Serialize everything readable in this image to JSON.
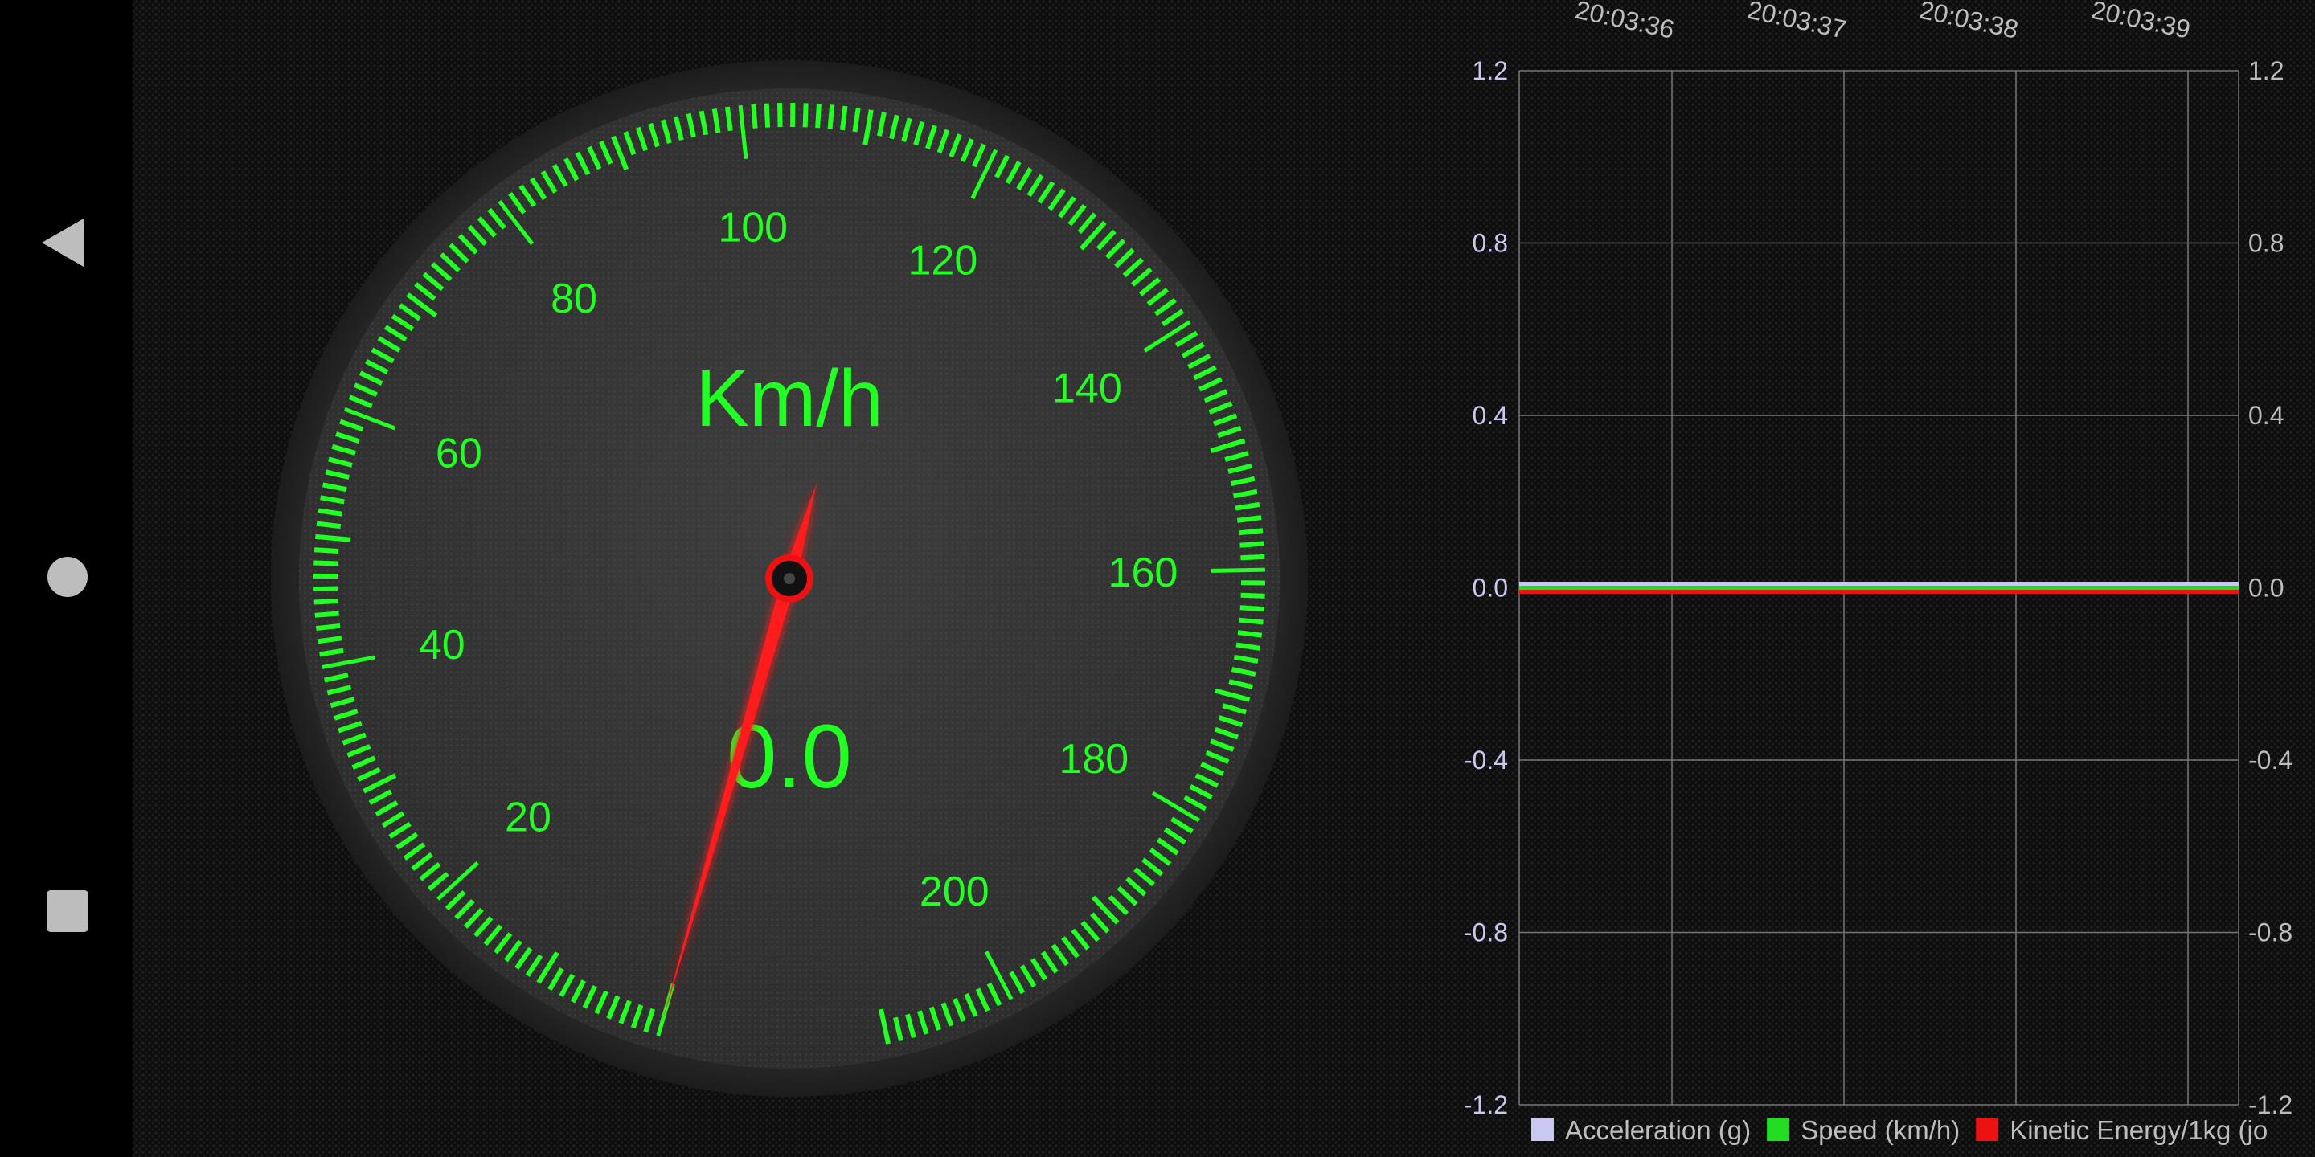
{
  "nav": {
    "back_icon": "triangle-back-icon",
    "home_icon": "circle-home-icon",
    "recents_icon": "square-recents-icon"
  },
  "speedometer": {
    "unit": "Km/h",
    "speed_value": "0.0",
    "speed": 0,
    "scale_labels": [
      "20",
      "40",
      "60",
      "80",
      "100",
      "120",
      "140",
      "160",
      "180",
      "200"
    ],
    "scale_min": 0,
    "scale_max": 210,
    "colors": {
      "ticks": "#22ff22",
      "needle": "#ff1a1a",
      "face": "#3a3a3a"
    }
  },
  "chart_data": {
    "type": "line",
    "x_labels": [
      "20:03:36",
      "20:03:37",
      "20:03:38",
      "20:03:39"
    ],
    "y_ticks_left": [
      "1.2",
      "0.8",
      "0.4",
      "0.0",
      "-0.4",
      "-0.8",
      "-1.2"
    ],
    "y_ticks_right": [
      "1.2",
      "0.8",
      "0.4",
      "0.0",
      "-0.4",
      "-0.8",
      "-1.2"
    ],
    "ylim": [
      -1.2,
      1.2
    ],
    "grid": true,
    "legend_position": "bottom",
    "series": [
      {
        "name": "Acceleration (g)",
        "color": "#c8c8f0",
        "values": [
          0,
          0,
          0,
          0
        ]
      },
      {
        "name": "Speed (km/h)",
        "color": "#22dd22",
        "values": [
          0,
          0,
          0,
          0
        ]
      },
      {
        "name": "Kinetic Energy/1kg (jo",
        "color": "#ee1111",
        "values": [
          0,
          0,
          0,
          0
        ]
      }
    ]
  }
}
